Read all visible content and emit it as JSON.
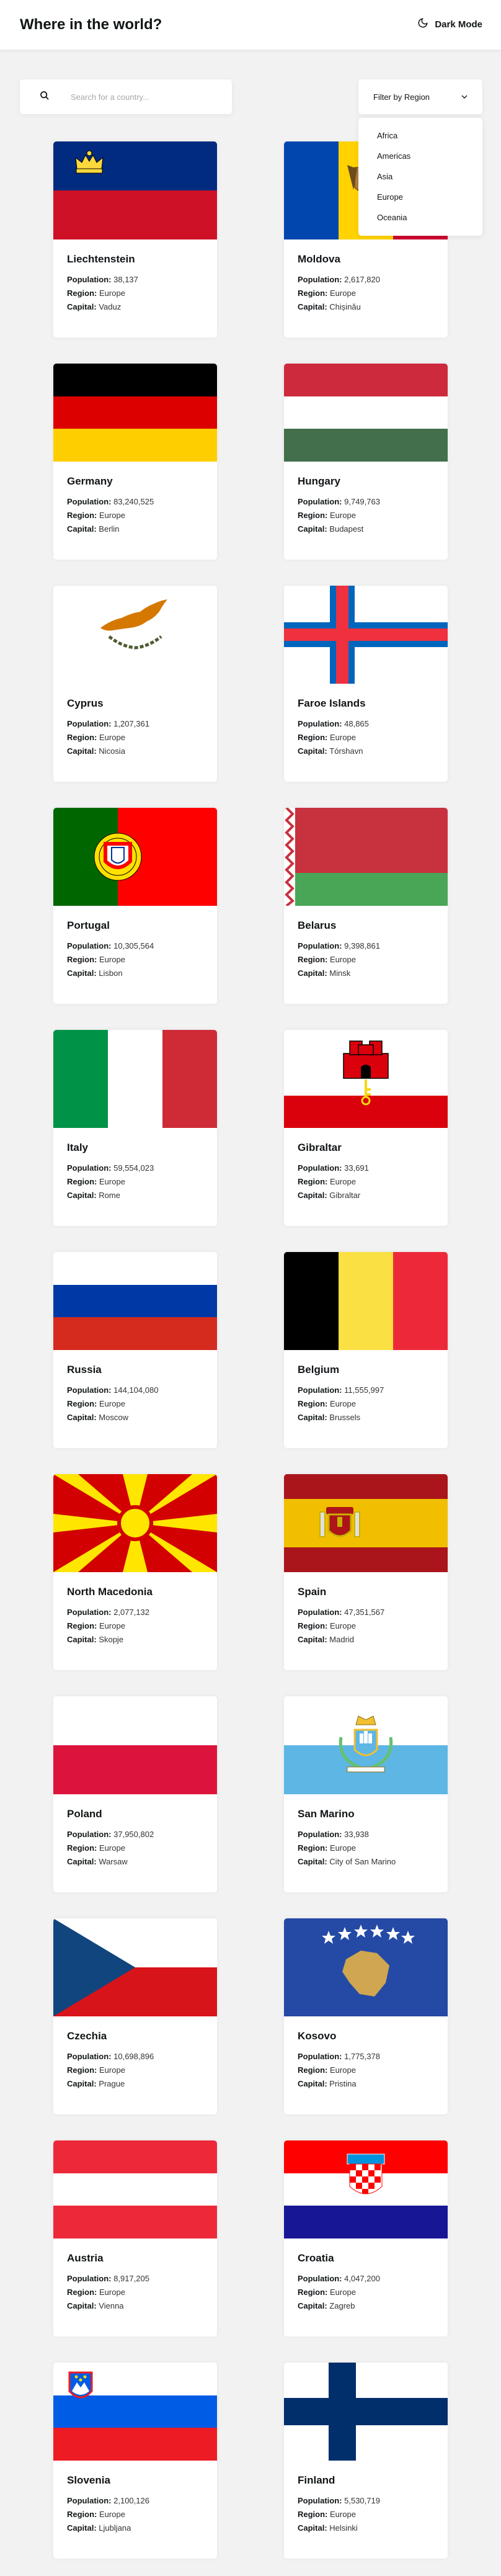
{
  "header": {
    "title": "Where in the world?",
    "dark_mode_label": "Dark Mode"
  },
  "search": {
    "placeholder": "Search for a country..."
  },
  "filter": {
    "label": "Filter by Region",
    "options": [
      "Africa",
      "Americas",
      "Asia",
      "Europe",
      "Oceania"
    ]
  },
  "labels": {
    "population": "Population:",
    "region": "Region:",
    "capital": "Capital:"
  },
  "countries": [
    {
      "name": "Liechtenstein",
      "population": "38,137",
      "region": "Europe",
      "capital": "Vaduz",
      "flag": "liechtenstein-flag"
    },
    {
      "name": "Moldova",
      "population": "2,617,820",
      "region": "Europe",
      "capital": "Chișinău",
      "flag": "moldova-flag"
    },
    {
      "name": "Germany",
      "population": "83,240,525",
      "region": "Europe",
      "capital": "Berlin",
      "flag": "germany-flag"
    },
    {
      "name": "Hungary",
      "population": "9,749,763",
      "region": "Europe",
      "capital": "Budapest",
      "flag": "hungary-flag"
    },
    {
      "name": "Cyprus",
      "population": "1,207,361",
      "region": "Europe",
      "capital": "Nicosia",
      "flag": "cyprus-flag"
    },
    {
      "name": "Faroe Islands",
      "population": "48,865",
      "region": "Europe",
      "capital": "Tórshavn",
      "flag": "faroe-islands-flag"
    },
    {
      "name": "Portugal",
      "population": "10,305,564",
      "region": "Europe",
      "capital": "Lisbon",
      "flag": "portugal-flag"
    },
    {
      "name": "Belarus",
      "population": "9,398,861",
      "region": "Europe",
      "capital": "Minsk",
      "flag": "belarus-flag"
    },
    {
      "name": "Italy",
      "population": "59,554,023",
      "region": "Europe",
      "capital": "Rome",
      "flag": "italy-flag"
    },
    {
      "name": "Gibraltar",
      "population": "33,691",
      "region": "Europe",
      "capital": "Gibraltar",
      "flag": "gibraltar-flag"
    },
    {
      "name": "Russia",
      "population": "144,104,080",
      "region": "Europe",
      "capital": "Moscow",
      "flag": "russia-flag"
    },
    {
      "name": "Belgium",
      "population": "11,555,997",
      "region": "Europe",
      "capital": "Brussels",
      "flag": "belgium-flag"
    },
    {
      "name": "North Macedonia",
      "population": "2,077,132",
      "region": "Europe",
      "capital": "Skopje",
      "flag": "north-macedonia-flag"
    },
    {
      "name": "Spain",
      "population": "47,351,567",
      "region": "Europe",
      "capital": "Madrid",
      "flag": "spain-flag"
    },
    {
      "name": "Poland",
      "population": "37,950,802",
      "region": "Europe",
      "capital": "Warsaw",
      "flag": "poland-flag"
    },
    {
      "name": "San Marino",
      "population": "33,938",
      "region": "Europe",
      "capital": "City of San Marino",
      "flag": "san-marino-flag"
    },
    {
      "name": "Czechia",
      "population": "10,698,896",
      "region": "Europe",
      "capital": "Prague",
      "flag": "czechia-flag"
    },
    {
      "name": "Kosovo",
      "population": "1,775,378",
      "region": "Europe",
      "capital": "Pristina",
      "flag": "kosovo-flag"
    },
    {
      "name": "Austria",
      "population": "8,917,205",
      "region": "Europe",
      "capital": "Vienna",
      "flag": "austria-flag"
    },
    {
      "name": "Croatia",
      "population": "4,047,200",
      "region": "Europe",
      "capital": "Zagreb",
      "flag": "croatia-flag"
    },
    {
      "name": "Slovenia",
      "population": "2,100,126",
      "region": "Europe",
      "capital": "Ljubljana",
      "flag": "slovenia-flag"
    },
    {
      "name": "Finland",
      "population": "5,530,719",
      "region": "Europe",
      "capital": "Helsinki",
      "flag": "finland-flag"
    }
  ]
}
